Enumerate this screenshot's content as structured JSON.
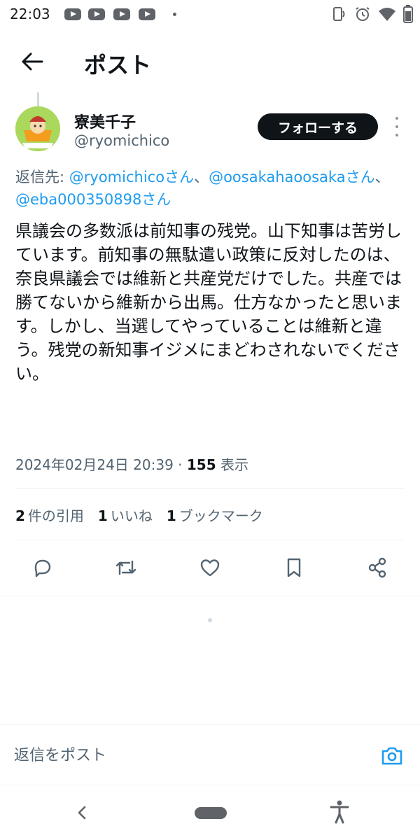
{
  "status_bar": {
    "time": "22:03",
    "notification_icons": [
      "youtube-icon",
      "youtube-icon",
      "youtube-icon",
      "youtube-icon"
    ],
    "system_icons": [
      "nfc-icon",
      "alarm-icon",
      "wifi-icon",
      "battery-icon"
    ]
  },
  "header": {
    "back_icon": "arrow-left-icon",
    "title": "ポスト"
  },
  "author": {
    "name": "寮美千子",
    "handle": "@ryomichico",
    "follow_label": "フォローする"
  },
  "reply_to": {
    "prefix": "返信先: ",
    "mention_1": "@ryomichicoさん",
    "sep_1": "、",
    "mention_2": "@oosakahaoosakaさん",
    "sep_2": "、",
    "mention_3": "@eba000350898さん"
  },
  "tweet": {
    "text": "県議会の多数派は前知事の残党。山下知事は苦労しています。前知事の無駄遣い政策に反対したのは、奈良県議会では維新と共産党だけでした。共産では勝てないから維新から出馬。仕方なかったと思います。しかし、当選してやっていることは維新と違う。残党の新知事イジメにまどわされないでください。"
  },
  "meta": {
    "timestamp": "2024年02月24日 20:39",
    "separator": " · ",
    "views_count": "155",
    "views_label": " 表示"
  },
  "stats": {
    "quotes_count": "2",
    "quotes_label": "件の引用",
    "likes_count": "1",
    "likes_label": "いいね",
    "bookmarks_count": "1",
    "bookmarks_label": "ブックマーク"
  },
  "actions": [
    "reply-icon",
    "retweet-icon",
    "like-icon",
    "bookmark-icon",
    "share-icon"
  ],
  "composer": {
    "placeholder": "返信をポスト",
    "camera_icon": "camera-icon"
  },
  "colors": {
    "accent": "#1d9bf0",
    "text_primary": "#0f1419",
    "text_secondary": "#536471",
    "follow_button_bg": "#0f1419",
    "divider": "#eff3f4"
  }
}
